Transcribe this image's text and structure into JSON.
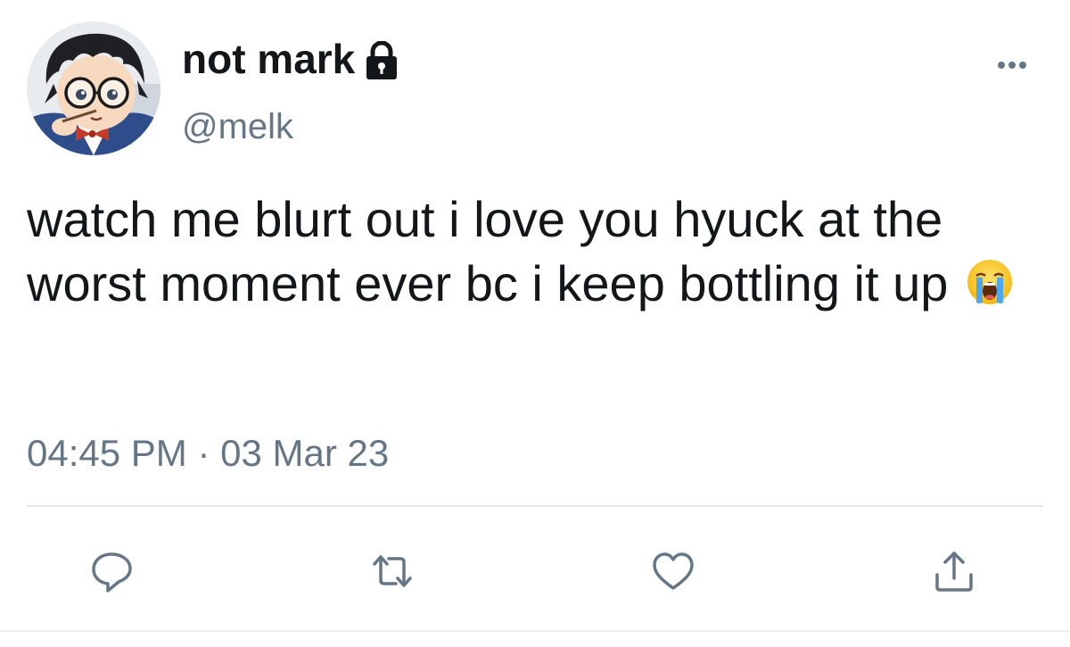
{
  "user": {
    "display_name": "not mark",
    "handle": "@melk",
    "avatar_icon": "anime-avatar",
    "protected_icon": "lock-icon"
  },
  "tweet": {
    "text": "watch me blurt out i love you hyuck at the worst moment ever bc i keep bottling it up",
    "emoji": "loudly-crying-face",
    "time": "04:45 PM",
    "separator": "·",
    "date": "03 Mar 23"
  },
  "actions": [
    {
      "name": "reply",
      "icon": "reply-icon"
    },
    {
      "name": "retweet",
      "icon": "retweet-icon"
    },
    {
      "name": "like",
      "icon": "heart-icon"
    },
    {
      "name": "share",
      "icon": "share-icon"
    }
  ],
  "colors": {
    "text": "#14171a",
    "secondary": "#657786",
    "divider": "#e1e8ed"
  }
}
